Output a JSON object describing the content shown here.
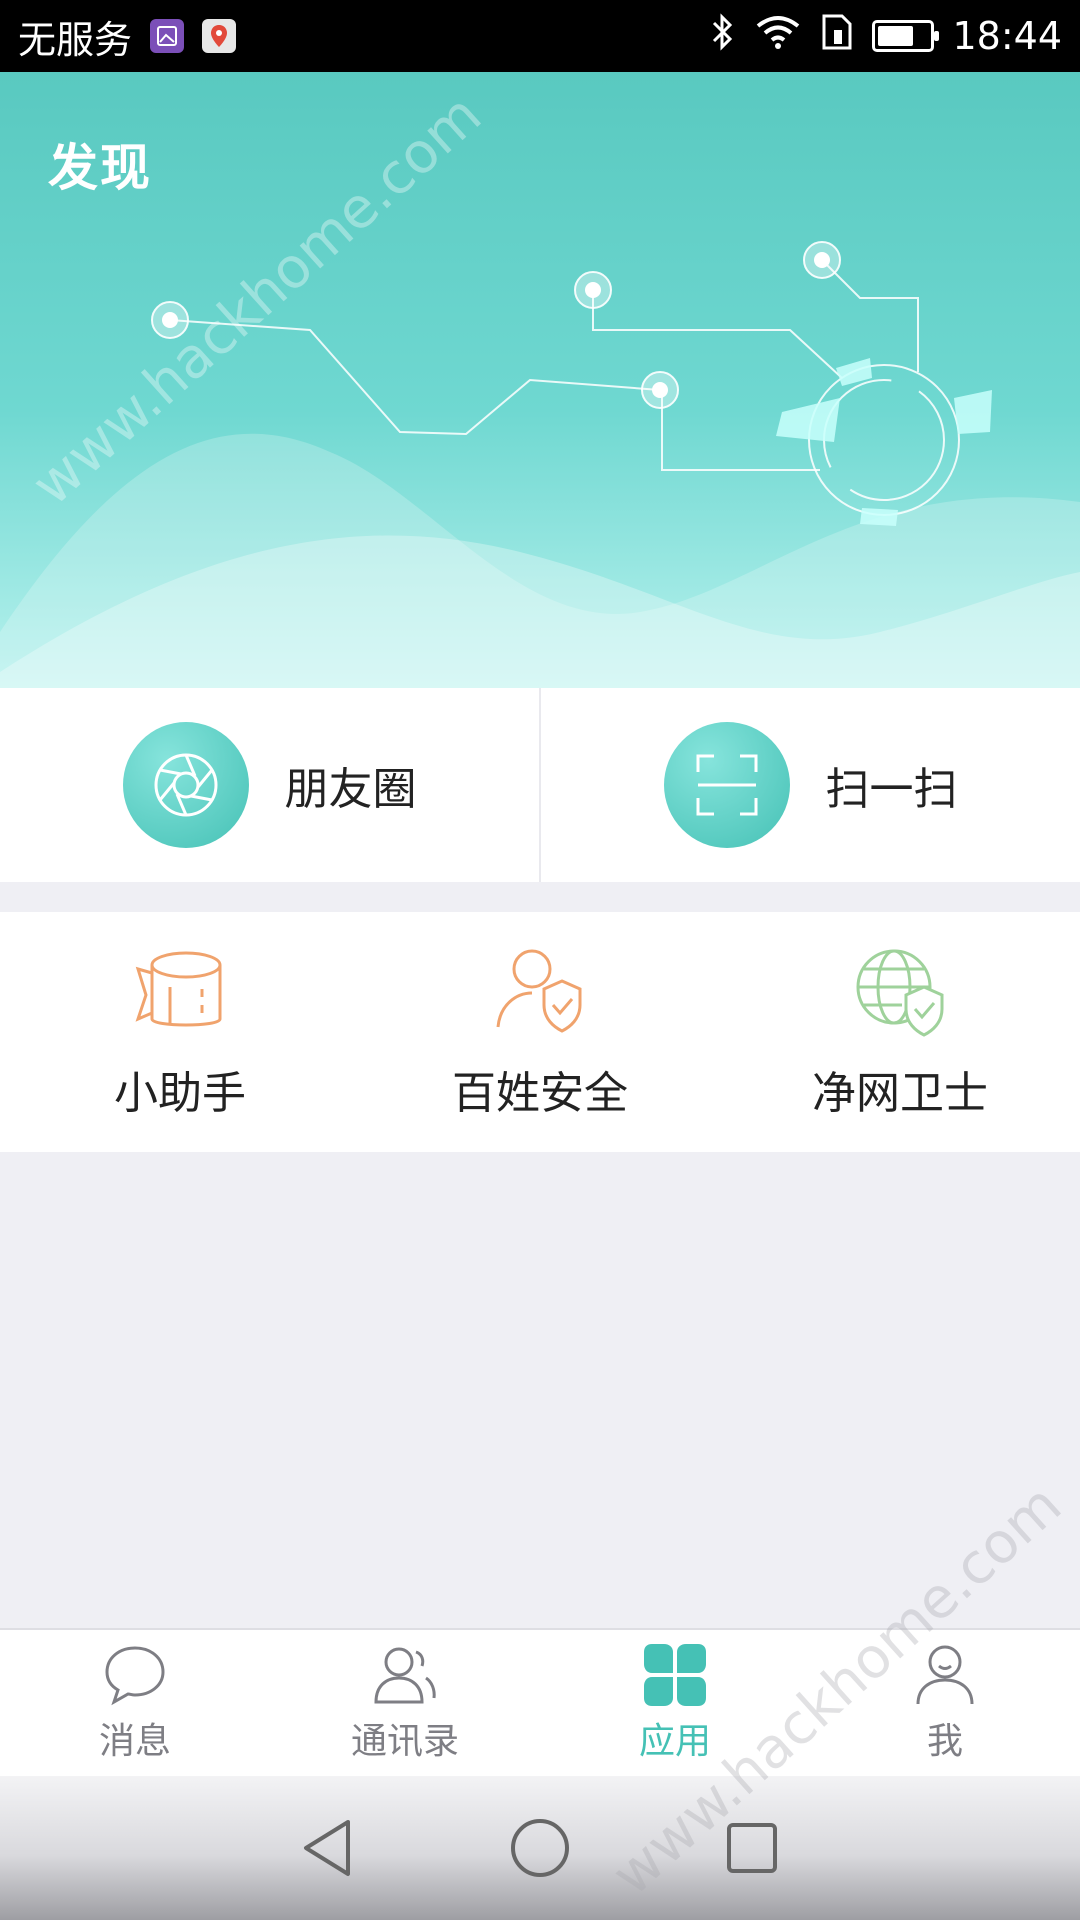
{
  "status_bar": {
    "carrier": "无服务",
    "time": "18:44",
    "battery_level": 0.7
  },
  "banner": {
    "title": "发现"
  },
  "quick_actions": [
    {
      "label": "朋友圈",
      "icon": "aperture-icon"
    },
    {
      "label": "扫一扫",
      "icon": "scan-icon"
    }
  ],
  "apps": [
    {
      "label": "小助手",
      "icon": "assistant-icon",
      "color": "#f0a36d"
    },
    {
      "label": "百姓安全",
      "icon": "user-shield-icon",
      "color": "#f0a36d"
    },
    {
      "label": "净网卫士",
      "icon": "globe-shield-icon",
      "color": "#9fd29b"
    }
  ],
  "tabs": [
    {
      "label": "消息",
      "icon": "chat-bubble-icon",
      "active": false
    },
    {
      "label": "通讯录",
      "icon": "contacts-icon",
      "active": false
    },
    {
      "label": "应用",
      "icon": "apps-grid-icon",
      "active": true
    },
    {
      "label": "我",
      "icon": "profile-icon",
      "active": false
    }
  ],
  "watermark": "www.hackhome.com",
  "colors": {
    "accent": "#45c1b5",
    "banner_top": "#59c9c0",
    "orange_icon": "#f0a36d",
    "green_icon": "#9fd29b"
  }
}
